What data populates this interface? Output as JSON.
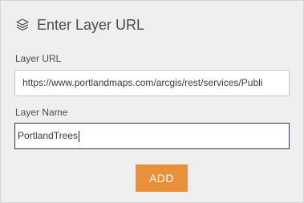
{
  "dialog": {
    "title": "Enter Layer URL",
    "header_icon": "layers-icon"
  },
  "layer_url": {
    "label": "Layer URL",
    "value": "https://www.portlandmaps.com/arcgis/rest/services/Publi"
  },
  "layer_name": {
    "label": "Layer Name",
    "value": "PortlandTrees"
  },
  "add_button": {
    "label": "ADD",
    "color": "#e8913a"
  }
}
